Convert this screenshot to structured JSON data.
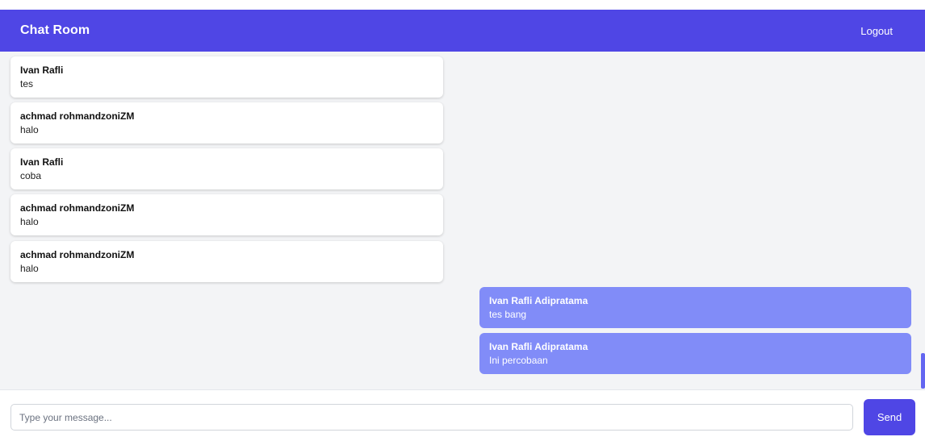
{
  "header": {
    "title": "Chat Room",
    "logout_label": "Logout"
  },
  "messages": [
    {
      "sender": "Ivan Rafli",
      "text": "tes",
      "direction": "incoming"
    },
    {
      "sender": "achmad rohmandzoniZM",
      "text": "halo",
      "direction": "incoming"
    },
    {
      "sender": "Ivan Rafli",
      "text": "coba",
      "direction": "incoming"
    },
    {
      "sender": "achmad rohmandzoniZM",
      "text": "halo",
      "direction": "incoming"
    },
    {
      "sender": "achmad rohmandzoniZM",
      "text": "halo",
      "direction": "incoming"
    },
    {
      "sender": "Ivan Rafli Adipratama",
      "text": "tes bang",
      "direction": "outgoing"
    },
    {
      "sender": "Ivan Rafli Adipratama",
      "text": "Ini percobaan",
      "direction": "outgoing"
    }
  ],
  "composer": {
    "input_value": "",
    "placeholder": "Type your message...",
    "send_label": "Send"
  },
  "colors": {
    "header_bg": "#4f46e5",
    "outgoing_bubble": "#818cf8",
    "incoming_bubble": "#ffffff",
    "chat_bg": "#f3f4f6",
    "send_button": "#4f46e5"
  }
}
